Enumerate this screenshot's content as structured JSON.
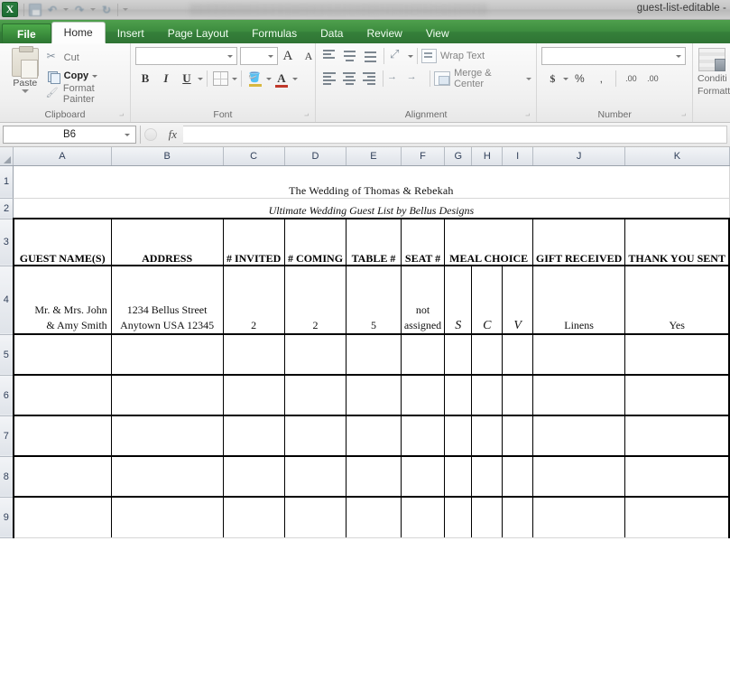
{
  "window": {
    "title": "guest-list-editable -",
    "app_icon": "excel-logo-icon",
    "quick_access": [
      "save-icon",
      "undo-icon",
      "redo-icon",
      "customize-icon"
    ]
  },
  "ribbon": {
    "tabs": [
      {
        "label": "File",
        "active": false,
        "file": true
      },
      {
        "label": "Home",
        "active": true
      },
      {
        "label": "Insert",
        "active": false
      },
      {
        "label": "Page Layout",
        "active": false
      },
      {
        "label": "Formulas",
        "active": false
      },
      {
        "label": "Data",
        "active": false
      },
      {
        "label": "Review",
        "active": false
      },
      {
        "label": "View",
        "active": false
      }
    ],
    "clipboard": {
      "label": "Clipboard",
      "paste": "Paste",
      "cut": "Cut",
      "copy": "Copy",
      "format_painter": "Format Painter"
    },
    "font": {
      "label": "Font",
      "font_name": "",
      "font_size": "",
      "bold": "B",
      "italic": "I",
      "underline": "U",
      "grow": "A",
      "shrink": "A"
    },
    "alignment": {
      "label": "Alignment",
      "wrap_text": "Wrap Text",
      "merge_center": "Merge & Center"
    },
    "number": {
      "label": "Number",
      "format": "",
      "currency": "$",
      "percent": "%",
      "comma": ",",
      "inc_dec": ".00",
      "dec_dec": ".00"
    },
    "styles": {
      "conditional_line1": "Conditi",
      "conditional_line2": "Formatt"
    }
  },
  "formula_bar": {
    "name_box": "B6",
    "formula": ""
  },
  "sheet": {
    "column_headers": [
      "A",
      "B",
      "C",
      "D",
      "E",
      "F",
      "G",
      "H",
      "I",
      "J",
      "K"
    ],
    "row_headers": [
      "1",
      "2",
      "3",
      "4",
      "5",
      "6",
      "7",
      "8",
      "9"
    ],
    "title": "The Wedding of Thomas & Rebekah",
    "subtitle": "Ultimate Wedding Guest List by Bellus Designs",
    "table_headers": {
      "guest_name": "GUEST NAME(S)",
      "address": "ADDRESS",
      "invited": "# INVITED",
      "coming": "# COMING",
      "table_num": "TABLE #",
      "seat_num": "SEAT #",
      "meal_choice": "MEAL CHOICE",
      "gift_received": "GIFT RECEIVED",
      "thank_you": "THANK YOU SENT"
    },
    "row4": {
      "guest_name_line1": "Mr. & Mrs. John",
      "guest_name_line2": "& Amy Smith",
      "address_line1": "1234 Bellus Street",
      "address_line2": "Anytown USA 12345",
      "invited": "2",
      "coming": "2",
      "table_num": "5",
      "seat_line1": "not",
      "seat_line2": "assigned",
      "meal_s": "S",
      "meal_c": "C",
      "meal_v": "V",
      "gift_received": "Linens",
      "thank_you": "Yes"
    }
  },
  "colors": {
    "excel_green": "#3f9142",
    "file_tab_green": "#2c7531",
    "header_blue_text": "#31405a"
  }
}
